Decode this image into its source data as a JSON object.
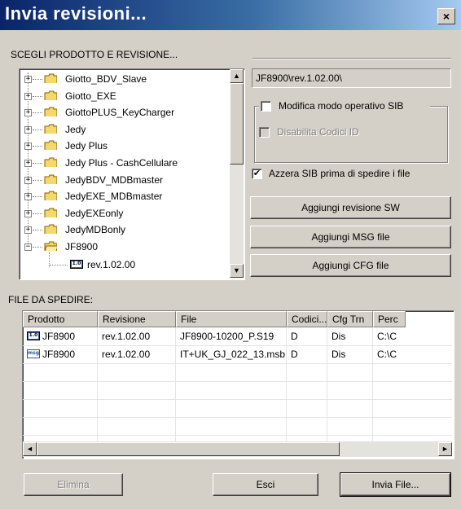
{
  "window": {
    "title": "Invia revisioni...",
    "close_glyph": "×"
  },
  "product_section": {
    "label": "SCEGLI PRODOTTO E REVISIONE..."
  },
  "tree": {
    "items": [
      {
        "label": "Giotto_BDV_Slave",
        "expander": "+"
      },
      {
        "label": "Giotto_EXE",
        "expander": "+"
      },
      {
        "label": "GiottoPLUS_KeyCharger",
        "expander": "+"
      },
      {
        "label": "Jedy",
        "expander": "+"
      },
      {
        "label": "Jedy Plus",
        "expander": "+"
      },
      {
        "label": "Jedy Plus - CashCellulare",
        "expander": "+"
      },
      {
        "label": "JedyBDV_MDBmaster",
        "expander": "+"
      },
      {
        "label": "JedyEXE_MDBmaster",
        "expander": "+"
      },
      {
        "label": "JedyEXEonly",
        "expander": "+"
      },
      {
        "label": "JedyMDBonly",
        "expander": "+"
      },
      {
        "label": "JF8900",
        "expander": "−"
      }
    ],
    "child": {
      "label": "rev.1.02.00",
      "icon_text": "1.0"
    },
    "scroll_up_glyph": "▲",
    "scroll_down_glyph": "▼"
  },
  "path_field": {
    "value": "JF8900\\rev.1.02.00\\"
  },
  "options": {
    "modifica_modo": {
      "label": "Modifica modo operativo SIB",
      "checked": false
    },
    "disabilita_codici": {
      "label": "Disabilita Codici ID",
      "checked": false,
      "disabled": true
    },
    "azzera_sib": {
      "label": "Azzera SIB prima di spedire i file",
      "checked": true,
      "mark": "✔"
    }
  },
  "buttons": {
    "add_revision": "Aggiungi revisione SW",
    "add_msg": "Aggiungi MSG file",
    "add_cfg": "Aggiungi CFG file",
    "delete": "Elimina",
    "exit": "Esci",
    "send": "Invia File..."
  },
  "files_section": {
    "label": "FILE DA SPEDIRE:"
  },
  "file_table": {
    "columns": [
      "Prodotto",
      "Revisione",
      "File",
      "Codici...",
      "Cfg Trn",
      "Perc"
    ],
    "rows": [
      {
        "icon": "1.0",
        "prodotto": "JF8900",
        "revisione": "rev.1.02.00",
        "file": "JF8900-10200_P.S19",
        "codici": "D",
        "cfg": "Dis",
        "perc": "C:\\C"
      },
      {
        "icon": "msg",
        "prodotto": "JF8900",
        "revisione": "rev.1.02.00",
        "file": "IT+UK_GJ_022_13.msb",
        "codici": "D",
        "cfg": "Dis",
        "perc": "C:\\C"
      }
    ],
    "scroll_left_glyph": "◄",
    "scroll_right_glyph": "►"
  },
  "colors": {
    "face": "#d4d0c8",
    "title_start": "#0a246a",
    "title_end": "#a6caf0",
    "folder": "#f4d86b"
  }
}
